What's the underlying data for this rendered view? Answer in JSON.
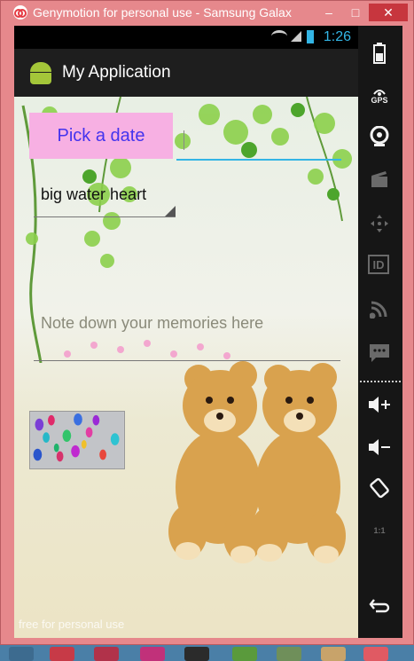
{
  "window": {
    "title": "Genymotion for personal use - Samsung Galax",
    "minimize": "–",
    "maximize": "□",
    "close": "✕"
  },
  "status_bar": {
    "time": "1:26"
  },
  "action_bar": {
    "title": "My Application"
  },
  "content": {
    "pick_button": "Pick a date",
    "spinner_value": "big water heart",
    "memo_placeholder": "Note down your memories here",
    "watermark": "free for personal use"
  },
  "sidebar": {
    "gps_label": "GPS",
    "id_label": "ID",
    "scale_label": "1:1"
  },
  "colors": {
    "pick_button_bg": "#f7b0e3",
    "pick_button_text": "#4433ee",
    "accent": "#33b5e5",
    "window_frame": "#e6888c"
  }
}
